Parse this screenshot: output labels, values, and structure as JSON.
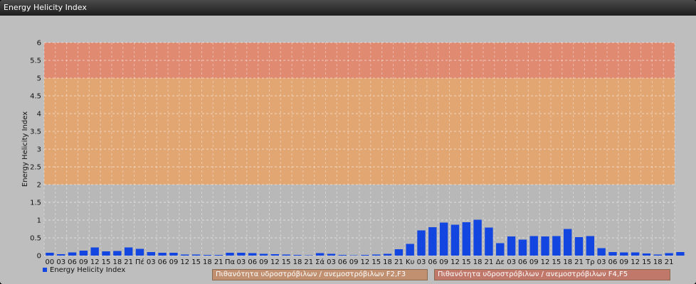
{
  "window": {
    "title": "Energy Helicity Index"
  },
  "colors": {
    "bar": "#1346e0",
    "zone_high": "#e08a72",
    "zone_mid": "#e2a672",
    "zone_low": "#b8b8b8",
    "badge_mid": "#c09070",
    "badge_high": "#c0786a"
  },
  "legend": {
    "label": "Energy Helicity Index"
  },
  "zones": [
    {
      "label": "Πιθανότητα υδροστρόβιλων / ανεμοστρόβιλων F2,F3",
      "range": [
        2,
        5
      ]
    },
    {
      "label": "Πιθανότητα υδροστρόβιλων / ανεμοστρόβιλων F4,F5",
      "range": [
        5,
        6
      ]
    }
  ],
  "chart_data": {
    "type": "bar",
    "title": "Energy Helicity Index",
    "xlabel": "",
    "ylabel": "Energy Helicity Index",
    "ylim": [
      0,
      6
    ],
    "yticks": [
      "0",
      "0.5",
      "1",
      "1.5",
      "2",
      "2.5",
      "3",
      "3.5",
      "4",
      "4.5",
      "5",
      "5.5",
      "6"
    ],
    "grid": true,
    "legend_position": "bottom-left",
    "categories": [
      "00",
      "03",
      "06",
      "09",
      "12",
      "15",
      "18",
      "21",
      "Πέ",
      "03",
      "06",
      "09",
      "12",
      "15",
      "18",
      "21",
      "Πα",
      "03",
      "06",
      "09",
      "12",
      "15",
      "18",
      "21",
      "Σά",
      "03",
      "06",
      "09",
      "12",
      "15",
      "18",
      "21",
      "Κυ",
      "03",
      "06",
      "09",
      "12",
      "15",
      "18",
      "21",
      "Δε",
      "03",
      "06",
      "09",
      "12",
      "15",
      "18",
      "21",
      "Τρ",
      "03",
      "06",
      "09",
      "12",
      "15",
      "18",
      "21"
    ],
    "series": [
      {
        "name": "Energy Helicity Index",
        "values": [
          0.08,
          0.04,
          0.09,
          0.14,
          0.23,
          0.12,
          0.13,
          0.23,
          0.19,
          0.1,
          0.08,
          0.08,
          0.03,
          0.03,
          0.02,
          0.02,
          0.08,
          0.08,
          0.07,
          0.05,
          0.04,
          0.03,
          0.02,
          0.01,
          0.07,
          0.05,
          0.02,
          0.01,
          0.02,
          0.03,
          0.05,
          0.18,
          0.33,
          0.71,
          0.8,
          0.93,
          0.87,
          0.94,
          1.01,
          0.79,
          0.35,
          0.54,
          0.45,
          0.55,
          0.54,
          0.55,
          0.75,
          0.52,
          0.55,
          0.21,
          0.1,
          0.09,
          0.09,
          0.06,
          0.03,
          0.07,
          0.1
        ]
      }
    ]
  }
}
